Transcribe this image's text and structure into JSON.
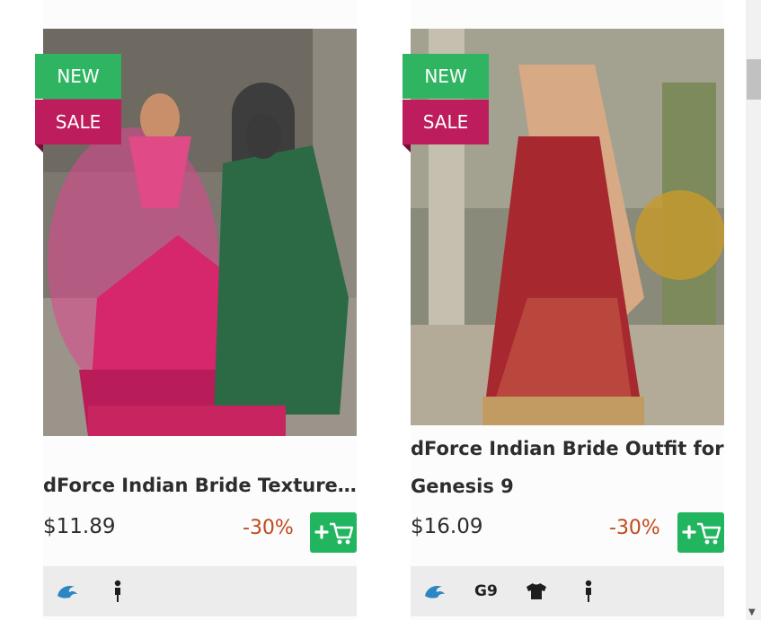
{
  "products": [
    {
      "badges": {
        "new": "NEW",
        "sale": "SALE"
      },
      "title": "dForce Indian Bride Texture Add-On",
      "price": "$11.89",
      "discount": "-30%",
      "meta_icons": [
        "daz-logo-icon",
        "figure-icon"
      ]
    },
    {
      "badges": {
        "new": "NEW",
        "sale": "SALE"
      },
      "title": "dForce Indian Bride Outfit for Genesis 9",
      "price": "$16.09",
      "discount": "-30%",
      "meta_icons": [
        "daz-logo-icon",
        "figure-icon",
        "clothing-icon"
      ],
      "generation": "G9"
    }
  ],
  "colors": {
    "new_badge": "#2fb562",
    "sale_badge": "#bd1d5c",
    "discount": "#c0491c",
    "cart_button": "#22b55f",
    "meta_bar": "#ececec"
  }
}
